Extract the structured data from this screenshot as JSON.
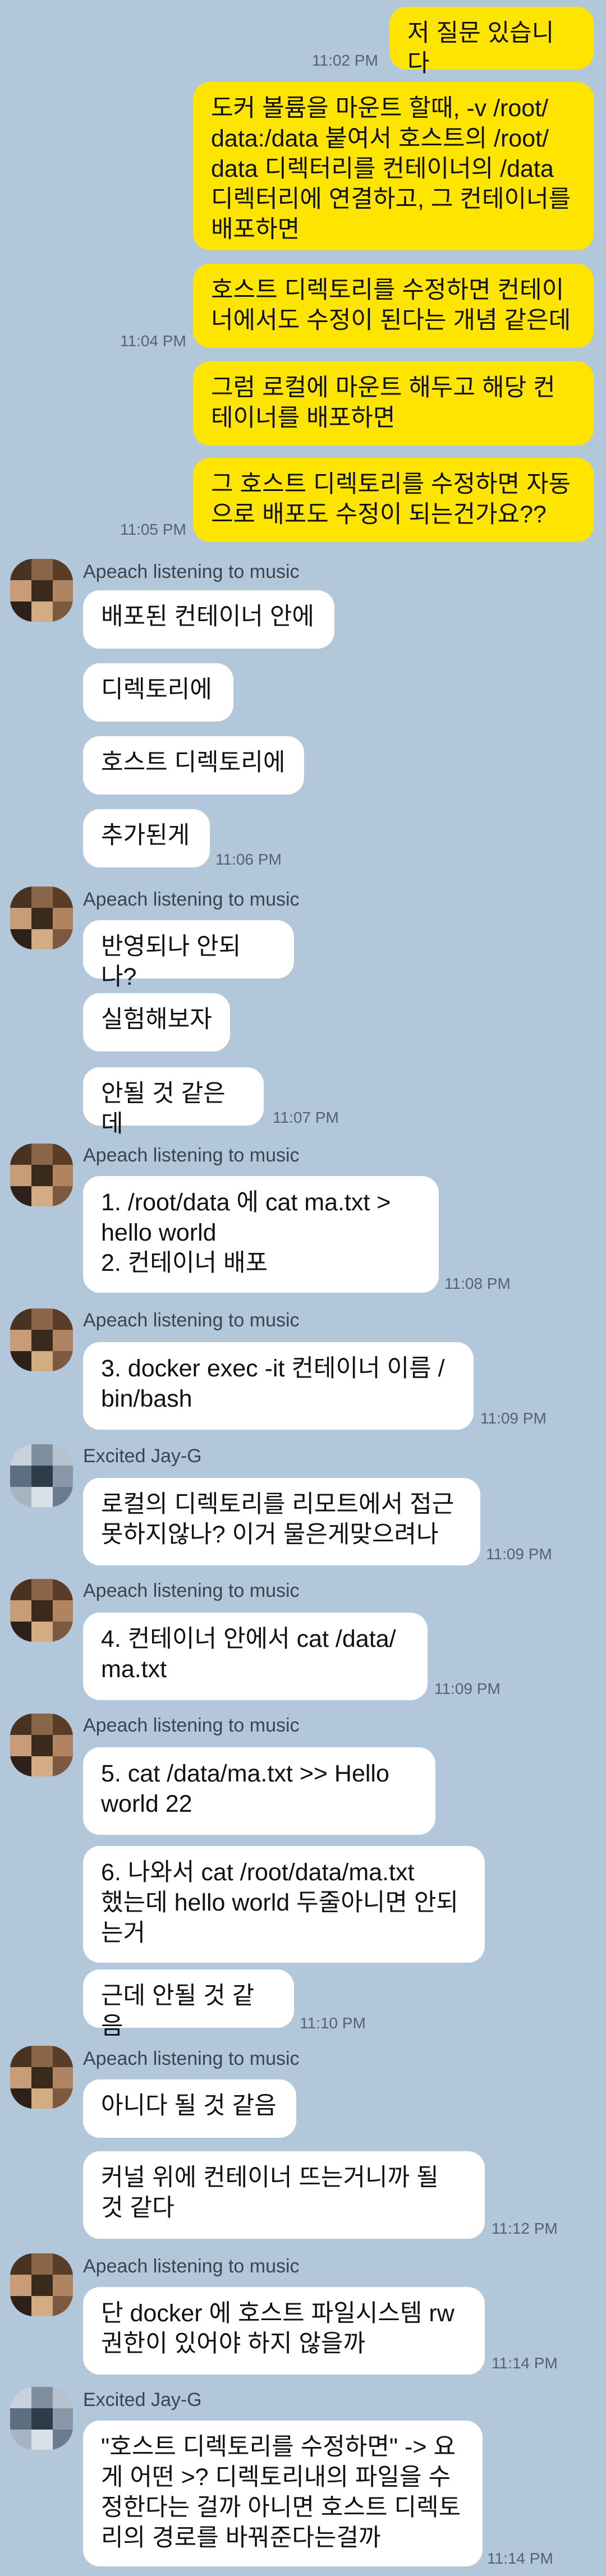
{
  "theme": {
    "background": "#b2c7da",
    "my_bubble": "#fee500",
    "their_bubble": "#ffffff"
  },
  "senders": {
    "apeach": {
      "name": "Apeach listening to music",
      "avatar_icon": "pixelated-avatar-brown"
    },
    "jayg": {
      "name": "Excited Jay-G",
      "avatar_icon": "pixelated-avatar-blue"
    }
  },
  "messages": [
    {
      "text": "저 질문 있습니다"
    },
    {
      "text": "도커 볼륨을 마운트 할때, -v /root/\ndata:/data 붙여서 호스트의 /root/\ndata 디렉터리를 컨테이너의 /data\n디렉터리에 연결하고, 그 컨테이너를\n배포하면"
    },
    {
      "text": "호스트 디렉토리를 수정하면 컨테이\n너에서도 수정이 된다는 개념 같은데"
    },
    {
      "text": "그럼 로컬에 마운트 해두고 해당 컨\n테이너를 배포하면"
    },
    {
      "text": "그 호스트 디렉토리를 수정하면 자동\n으로 배포도 수정이 되는건가요??"
    },
    {
      "text": "배포된 컨테이너 안에"
    },
    {
      "text": "디렉토리에"
    },
    {
      "text": "호스트 디렉토리에"
    },
    {
      "text": "추가된게"
    },
    {
      "text": "반영되나 안되나?"
    },
    {
      "text": "실험해보자"
    },
    {
      "text": "안될 것 같은데"
    },
    {
      "text": "1. /root/data 에 cat ma.txt >\nhello world\n2. 컨테이너 배포"
    },
    {
      "text": "3. docker exec -it 컨테이너 이름 /\nbin/bash"
    },
    {
      "text": "로컬의 디렉토리를 리모트에서 접근\n못하지않나? 이거 물은게맞으려나"
    },
    {
      "text": "4. 컨테이너 안에서 cat /data/\nma.txt"
    },
    {
      "text": "5. cat /data/ma.txt >> Hello\nworld 22"
    },
    {
      "text": "6. 나와서 cat /root/data/ma.txt\n했는데 hello world 두줄아니면 안되\n는거"
    },
    {
      "text": "근데 안될 것 같음"
    },
    {
      "text": "아니다 될 것 같음"
    },
    {
      "text": "커널 위에 컨테이너 뜨는거니까 될\n것 같다"
    },
    {
      "text": "단 docker 에 호스트 파일시스템 rw\n권한이 있어야 하지 않을까"
    },
    {
      "text": "\"호스트 디렉토리를 수정하면\" -> 요\n게 어떤 >? 디렉토리내의 파일을 수\n정한다는 걸까 아니면 호스트 디렉토\n리의 경로를 바꿔준다는걸까"
    }
  ],
  "times": [
    "11:02 PM",
    "11:04 PM",
    "11:05 PM",
    "11:06 PM",
    "11:07 PM",
    "11:08 PM",
    "11:09 PM",
    "11:09 PM",
    "11:09 PM",
    "11:10 PM",
    "11:12 PM",
    "11:14 PM",
    "11:14 PM"
  ]
}
